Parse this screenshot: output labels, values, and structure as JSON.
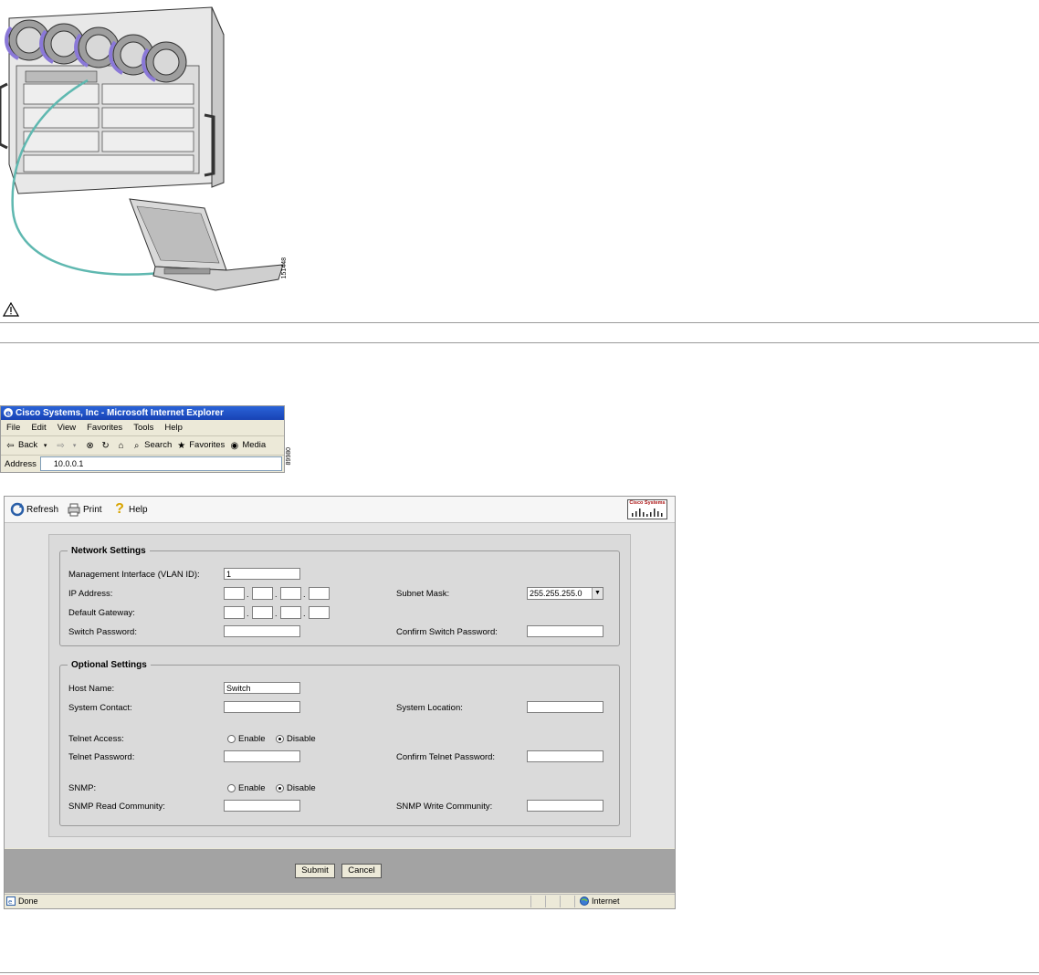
{
  "figures": {
    "hardware_id": "151448",
    "browser_id": "89980"
  },
  "ie": {
    "title": "Cisco Systems, Inc - Microsoft Internet Explorer",
    "menu": [
      "File",
      "Edit",
      "View",
      "Favorites",
      "Tools",
      "Help"
    ],
    "toolbar": {
      "back": "Back",
      "search": "Search",
      "favorites": "Favorites",
      "media": "Media"
    },
    "address_label": "Address",
    "address_value": "10.0.0.1"
  },
  "form": {
    "toolbar": {
      "refresh": "Refresh",
      "print": "Print",
      "help": "Help",
      "logo": "Cisco Systems"
    },
    "network": {
      "legend": "Network Settings",
      "mgmt_label": "Management Interface (VLAN ID):",
      "mgmt_value": "1",
      "ip_label": "IP Address:",
      "subnet_label": "Subnet Mask:",
      "subnet_value": "255.255.255.0",
      "gateway_label": "Default Gateway:",
      "switch_pw_label": "Switch Password:",
      "confirm_switch_pw_label": "Confirm Switch Password:"
    },
    "optional": {
      "legend": "Optional Settings",
      "host_label": "Host Name:",
      "host_value": "Switch",
      "contact_label": "System Contact:",
      "location_label": "System Location:",
      "telnet_label": "Telnet Access:",
      "enable": "Enable",
      "disable": "Disable",
      "telnet_pw_label": "Telnet Password:",
      "confirm_telnet_pw_label": "Confirm Telnet Password:",
      "snmp_label": "SNMP:",
      "snmp_read_label": "SNMP Read Community:",
      "snmp_write_label": "SNMP Write Community:"
    },
    "submit": "Submit",
    "cancel": "Cancel",
    "status": {
      "done": "Done",
      "zone": "Internet"
    }
  },
  "colors": {
    "cable": "#5fb8b0",
    "fan_accent": "#8a78d8",
    "ie_title": "#1f4fc4",
    "footer_gray": "#a3a3a3"
  }
}
